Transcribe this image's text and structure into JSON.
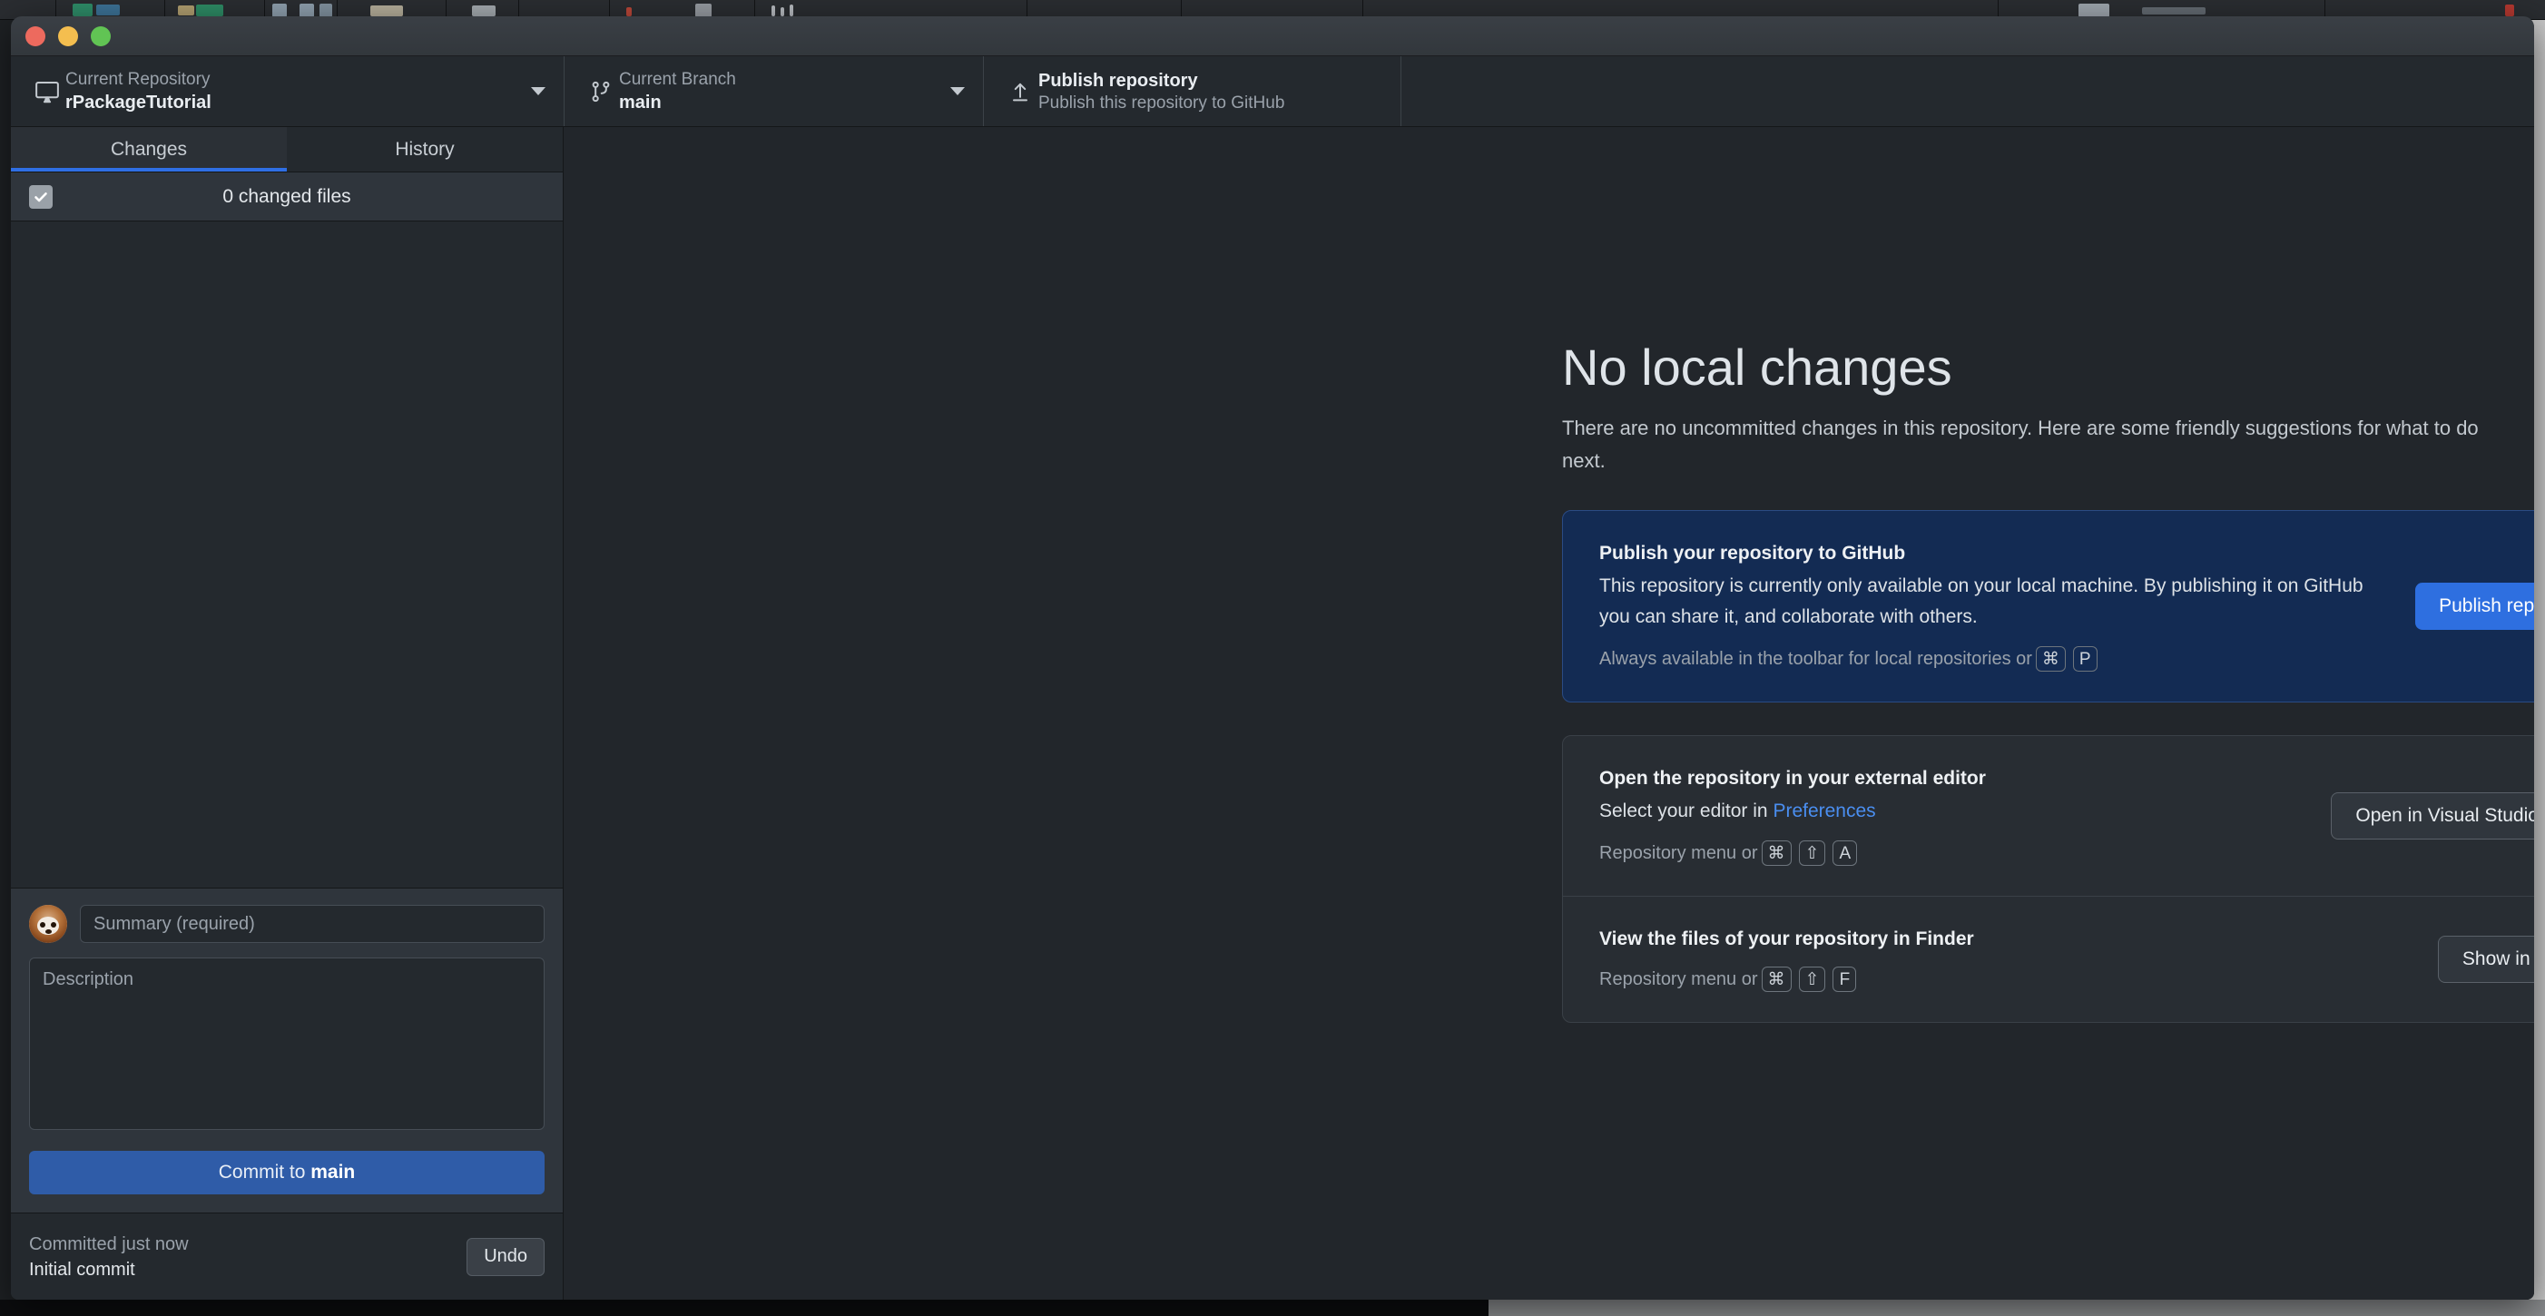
{
  "window": {
    "traffic_lights": [
      {
        "name": "close",
        "color": "#ED6A5E"
      },
      {
        "name": "minimize",
        "color": "#F4BE4F"
      },
      {
        "name": "zoom",
        "color": "#61C454"
      }
    ]
  },
  "toolbar": {
    "repository": {
      "icon": "desktop-monitor-icon",
      "label": "Current Repository",
      "value": "rPackageTutorial"
    },
    "branch": {
      "icon": "git-branch-icon",
      "label": "Current Branch",
      "value": "main"
    },
    "publish": {
      "icon": "upload-arrow-icon",
      "title": "Publish repository",
      "subtitle": "Publish this repository to GitHub"
    }
  },
  "sidebar": {
    "tabs": [
      {
        "label": "Changes",
        "active": true
      },
      {
        "label": "History",
        "active": false
      }
    ],
    "changed_files_label": "0 changed files",
    "changed_files_checked": true,
    "commit": {
      "summary_placeholder": "Summary (required)",
      "summary_value": "",
      "description_placeholder": "Description",
      "description_value": "",
      "button_prefix": "Commit to ",
      "button_branch": "main"
    },
    "undo": {
      "status": "Committed just now",
      "commit_message": "Initial commit",
      "button_label": "Undo"
    }
  },
  "main": {
    "title": "No local changes",
    "description": "There are no uncommitted changes in this repository. Here are some friendly suggestions for what to do next.",
    "cards": [
      {
        "id": "publish",
        "title": "Publish your repository to GitHub",
        "description": "This repository is currently only available on your local machine. By publishing it on GitHub you can share it, and collaborate with others.",
        "hint_prefix": "Always available in the toolbar for local repositories or",
        "keys": [
          "⌘",
          "P"
        ],
        "button_label": "Publish repository",
        "button_style": "primary",
        "accent": "#2e6fe0",
        "background": "#132b53"
      },
      {
        "id": "external-editor",
        "title": "Open the repository in your external editor",
        "description_prefix": "Select your editor in ",
        "description_link": "Preferences",
        "hint_prefix": "Repository menu or",
        "keys": [
          "⌘",
          "⇧",
          "A"
        ],
        "button_label": "Open in Visual Studio Code",
        "button_style": "secondary"
      },
      {
        "id": "show-in-finder",
        "title": "View the files of your repository in Finder",
        "hint_prefix": "Repository menu or",
        "keys": [
          "⌘",
          "⇧",
          "F"
        ],
        "button_label": "Show in Finder",
        "button_style": "secondary"
      }
    ],
    "illustration": "boxes-and-birds-illustration"
  },
  "colors": {
    "accent_blue": "#2e6fe4",
    "window_bg": "#22262b",
    "sidebar_bg": "#24292e",
    "card_bg": "#282d33",
    "publish_card_bg": "#132b53",
    "link": "#4a8ef0"
  }
}
